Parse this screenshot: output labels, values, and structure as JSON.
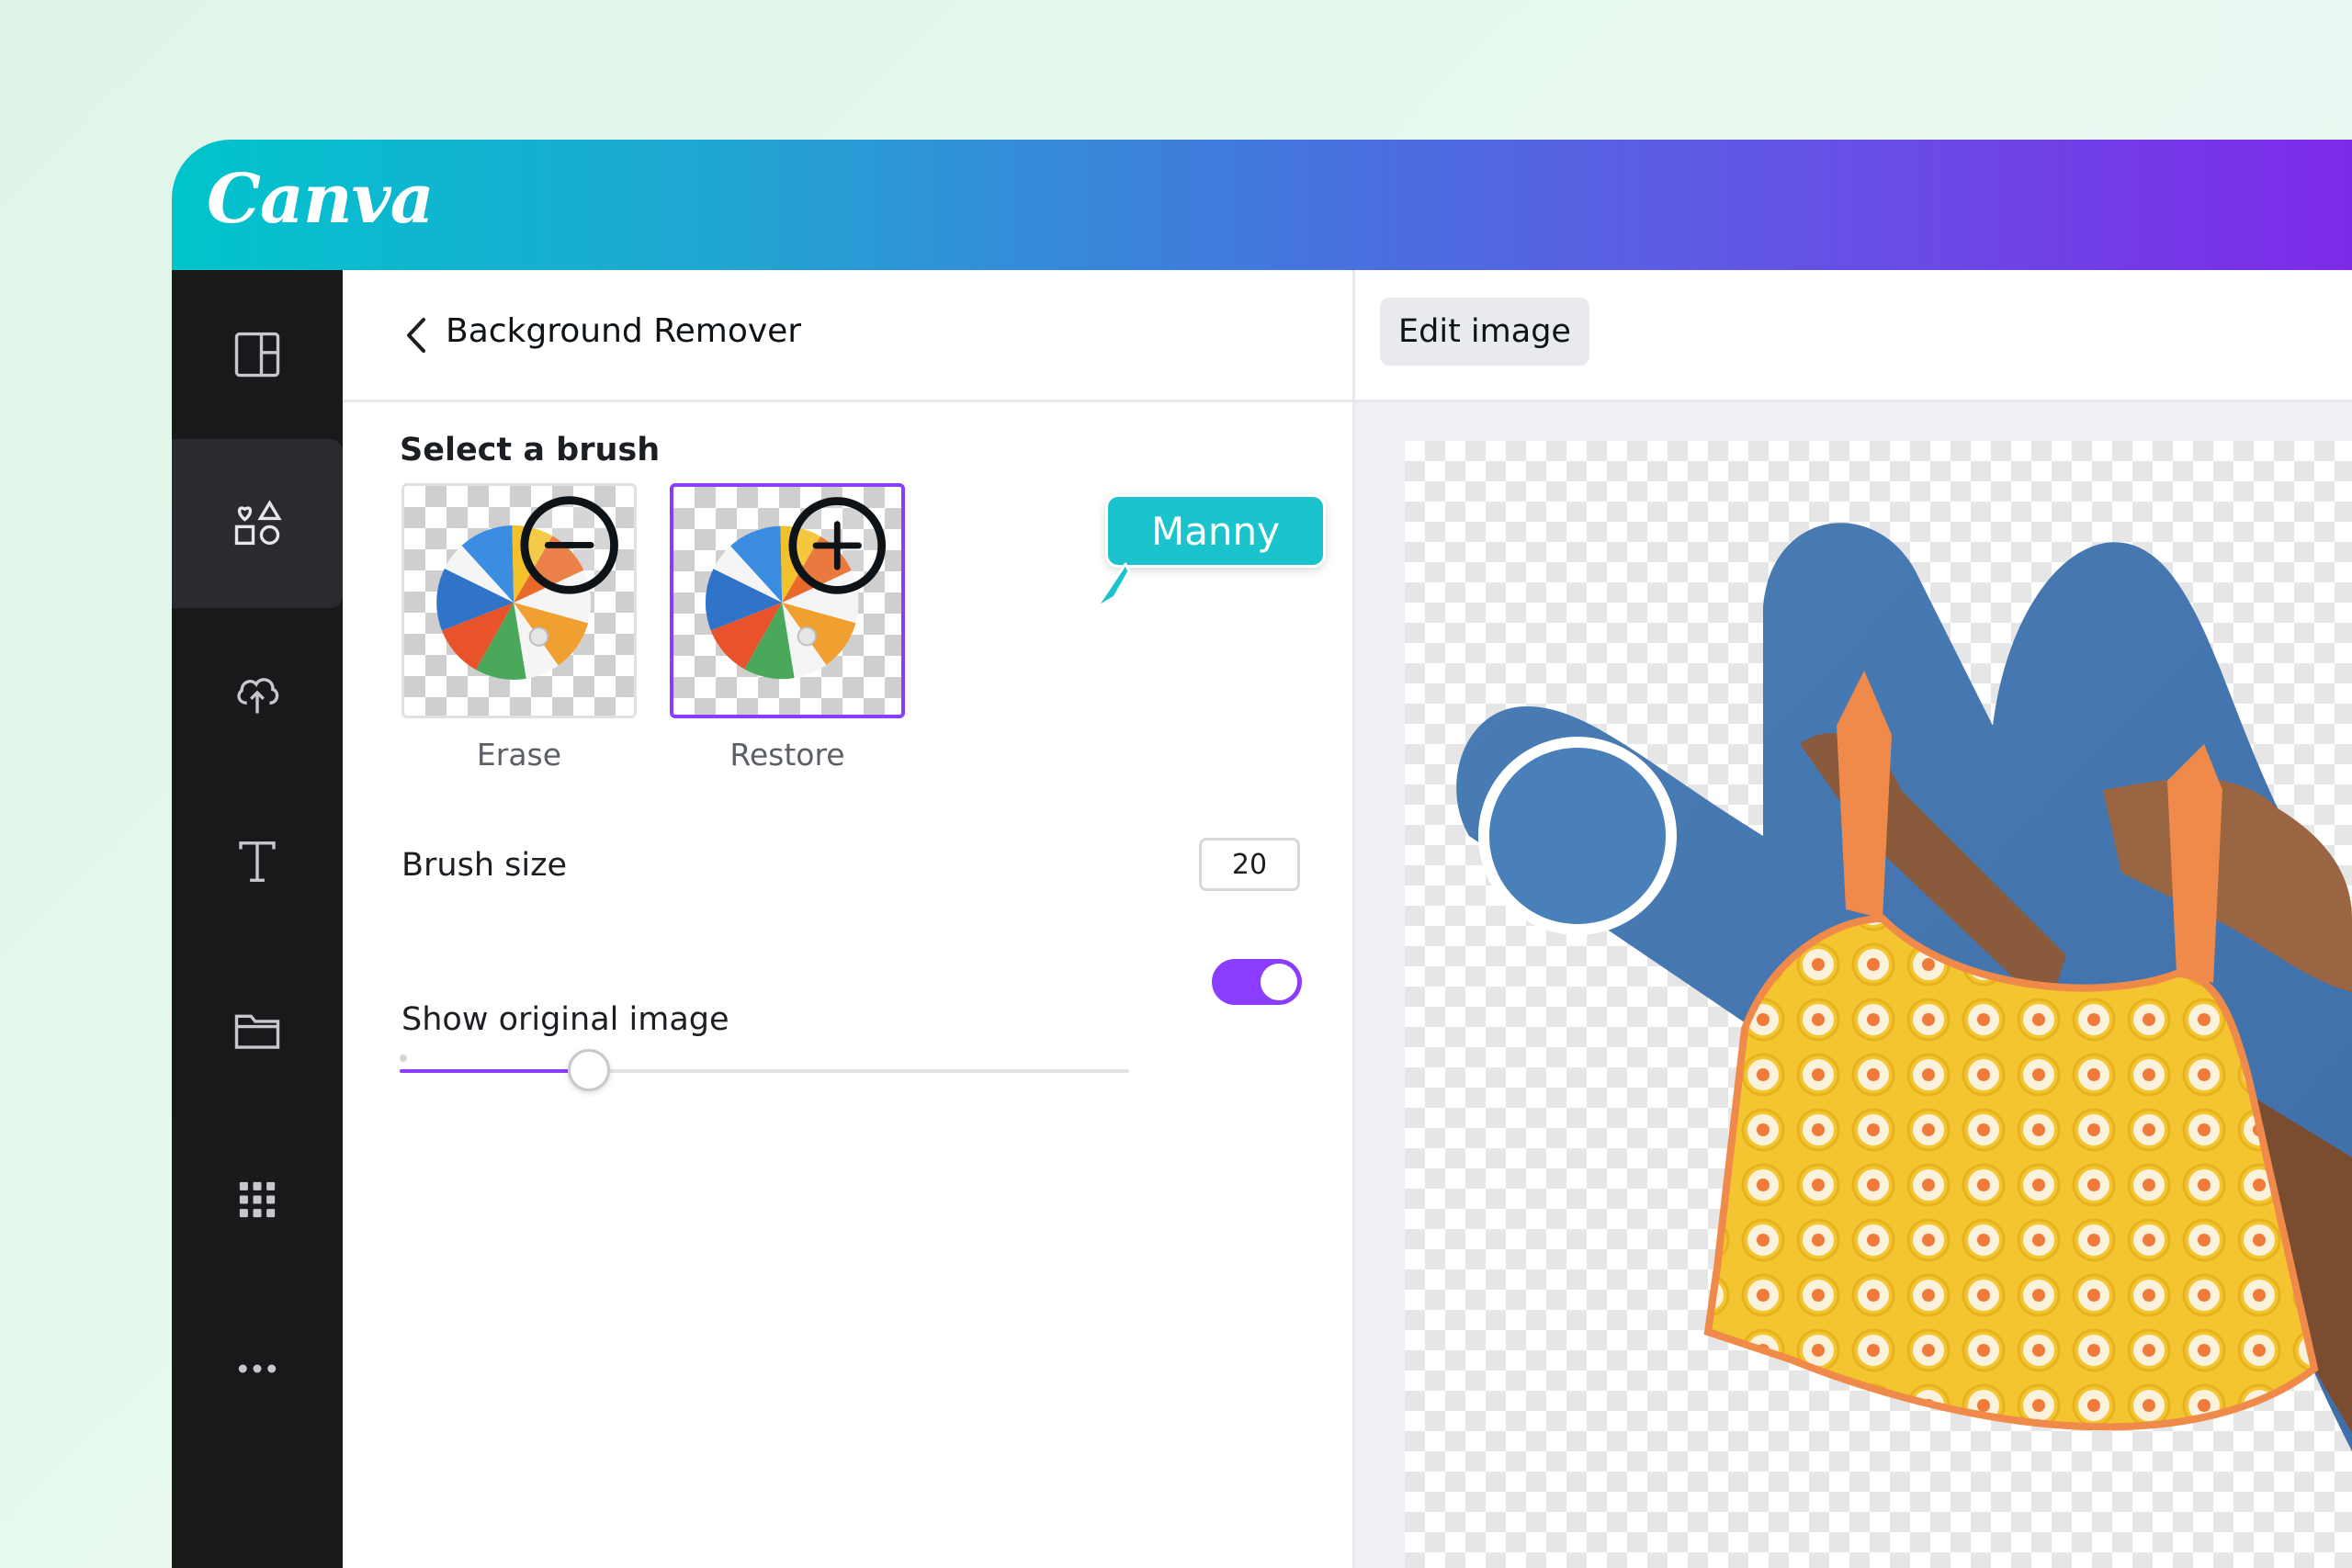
{
  "app": {
    "logo_text": "Canva",
    "brand_gradient": [
      "#00c4cc",
      "#7d2ae8"
    ]
  },
  "rail": {
    "items": [
      {
        "icon": "layout-icon",
        "active": false
      },
      {
        "icon": "elements-icon",
        "active": true
      },
      {
        "icon": "upload-cloud-icon",
        "active": false
      },
      {
        "icon": "text-icon",
        "active": false
      },
      {
        "icon": "folder-icon",
        "active": false
      },
      {
        "icon": "apps-grid-icon",
        "active": false
      },
      {
        "icon": "more-icon",
        "active": false
      }
    ]
  },
  "panel": {
    "title": "Background Remover",
    "select_brush_label": "Select a brush",
    "brushes": [
      {
        "label": "Erase",
        "icon": "minus-circle-icon",
        "selected": false
      },
      {
        "label": "Restore",
        "icon": "plus-circle-icon",
        "selected": true
      }
    ],
    "collaborator_tooltip": "Manny",
    "brush_size_label": "Brush size",
    "brush_size_value": "20",
    "brush_size_slider_fraction": 0.26,
    "show_original_label": "Show original image",
    "show_original_on": true,
    "accent_color": "#8b3dff"
  },
  "main": {
    "edit_image_label": "Edit image"
  }
}
